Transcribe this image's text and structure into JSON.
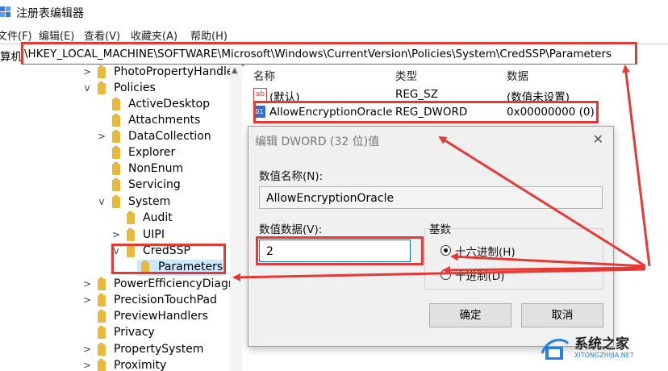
{
  "window": {
    "title": "注册表编辑器"
  },
  "menu": [
    "文件(F)",
    "编辑(E)",
    "查看(V)",
    "收藏夹(A)",
    "帮助(H)"
  ],
  "address": {
    "prefix": "算机",
    "path": "\\HKEY_LOCAL_MACHINE\\SOFTWARE\\Microsoft\\Windows\\CurrentVersion\\Policies\\System\\CredSSP\\Parameters"
  },
  "tree": [
    {
      "label": "PhotoPropertyHandle",
      "chevron": ">"
    },
    {
      "label": "Policies",
      "chevron": "v"
    },
    {
      "label": "ActiveDesktop",
      "chevron": ""
    },
    {
      "label": "Attachments",
      "chevron": ""
    },
    {
      "label": "DataCollection",
      "chevron": ">"
    },
    {
      "label": "Explorer",
      "chevron": ""
    },
    {
      "label": "NonEnum",
      "chevron": ""
    },
    {
      "label": "Servicing",
      "chevron": ""
    },
    {
      "label": "System",
      "chevron": "v"
    },
    {
      "label": "Audit",
      "chevron": ""
    },
    {
      "label": "UIPI",
      "chevron": ">"
    },
    {
      "label": "CredSSP",
      "chevron": "v"
    },
    {
      "label": "Parameters",
      "chevron": ""
    },
    {
      "label": "PowerEfficiencyDiagr",
      "chevron": ">"
    },
    {
      "label": "PrecisionTouchPad",
      "chevron": ">"
    },
    {
      "label": "PreviewHandlers",
      "chevron": ""
    },
    {
      "label": "Privacy",
      "chevron": ""
    },
    {
      "label": "PropertySystem",
      "chevron": ">"
    },
    {
      "label": "Proximity",
      "chevron": ">"
    }
  ],
  "list": {
    "headers": {
      "name": "名称",
      "type": "类型",
      "data": "数据"
    },
    "rows": [
      {
        "icon": "string-value-icon",
        "name": "(默认)",
        "type": "REG_SZ",
        "data": "(数值未设置)"
      },
      {
        "icon": "dword-value-icon",
        "name": "AllowEncryptionOracle",
        "type": "REG_DWORD",
        "data": "0x00000000 (0)"
      }
    ]
  },
  "dialog": {
    "title": "编辑 DWORD (32 位)值",
    "close": "✕",
    "name_label": "数值名称(N):",
    "name_value": "AllowEncryptionOracle",
    "data_label": "数值数据(V):",
    "data_value": "2",
    "base_label": "基数",
    "hex_label": "十六进制(H)",
    "dec_label": "十进制(D)",
    "ok": "确定",
    "cancel": "取消"
  },
  "watermark": {
    "text": "系统之家",
    "sub": "XITONGZHIJIA.NET"
  },
  "colors": {
    "annotation": "#e53935",
    "folder": "#e9b93b",
    "accent": "#0078d7"
  }
}
